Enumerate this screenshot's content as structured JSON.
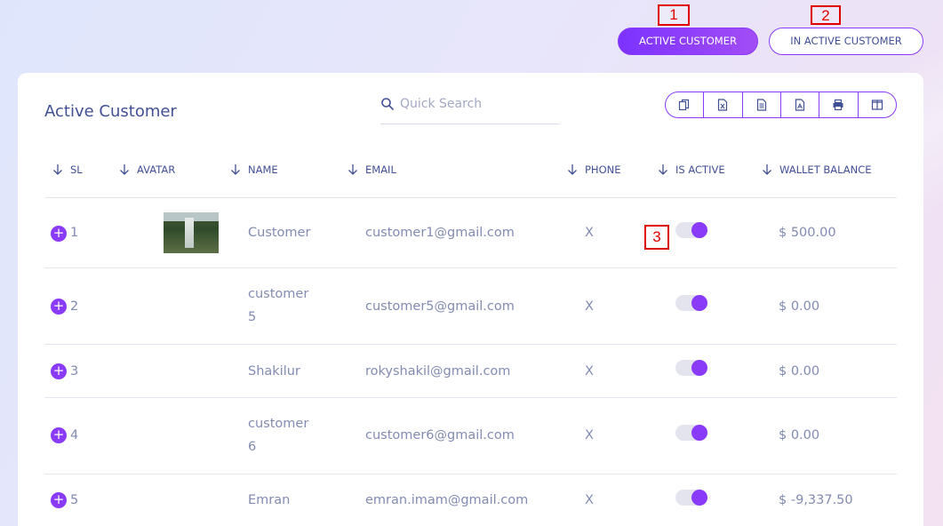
{
  "annotations": [
    "1",
    "2",
    "3"
  ],
  "tabs": {
    "active_label": "ACTIVE CUSTOMER",
    "inactive_label": "IN ACTIVE CUSTOMER"
  },
  "card": {
    "title": "Active Customer",
    "search_placeholder": "Quick Search"
  },
  "toolbar": [
    "copy-icon",
    "excel-icon",
    "csv-icon",
    "pdf-icon",
    "print-icon",
    "columns-icon"
  ],
  "table": {
    "headers": [
      "SL",
      "AVATAR",
      "NAME",
      "EMAIL",
      "PHONE",
      "IS ACTIVE",
      "WALLET BALANCE"
    ],
    "rows": [
      {
        "sl": "1",
        "avatar": true,
        "name1": "Customer",
        "name2": "",
        "email": "customer1@gmail.com",
        "phone": "X",
        "active": true,
        "balance": "$ 500.00"
      },
      {
        "sl": "2",
        "avatar": false,
        "name1": "customer",
        "name2": "5",
        "email": "customer5@gmail.com",
        "phone": "X",
        "active": true,
        "balance": "$ 0.00"
      },
      {
        "sl": "3",
        "avatar": false,
        "name1": "Shakilur",
        "name2": "",
        "email": "rokyshakil@gmail.com",
        "phone": "X",
        "active": true,
        "balance": "$ 0.00"
      },
      {
        "sl": "4",
        "avatar": false,
        "name1": "customer",
        "name2": "6",
        "email": "customer6@gmail.com",
        "phone": "X",
        "active": true,
        "balance": "$ 0.00"
      },
      {
        "sl": "5",
        "avatar": false,
        "name1": "Emran",
        "name2": "",
        "email": "emran.imam@gmail.com",
        "phone": "X",
        "active": true,
        "balance": "$ -9,337.50"
      }
    ]
  },
  "colors": {
    "accent": "#8a3af9",
    "text": "#415094",
    "muted": "#828bb2"
  }
}
